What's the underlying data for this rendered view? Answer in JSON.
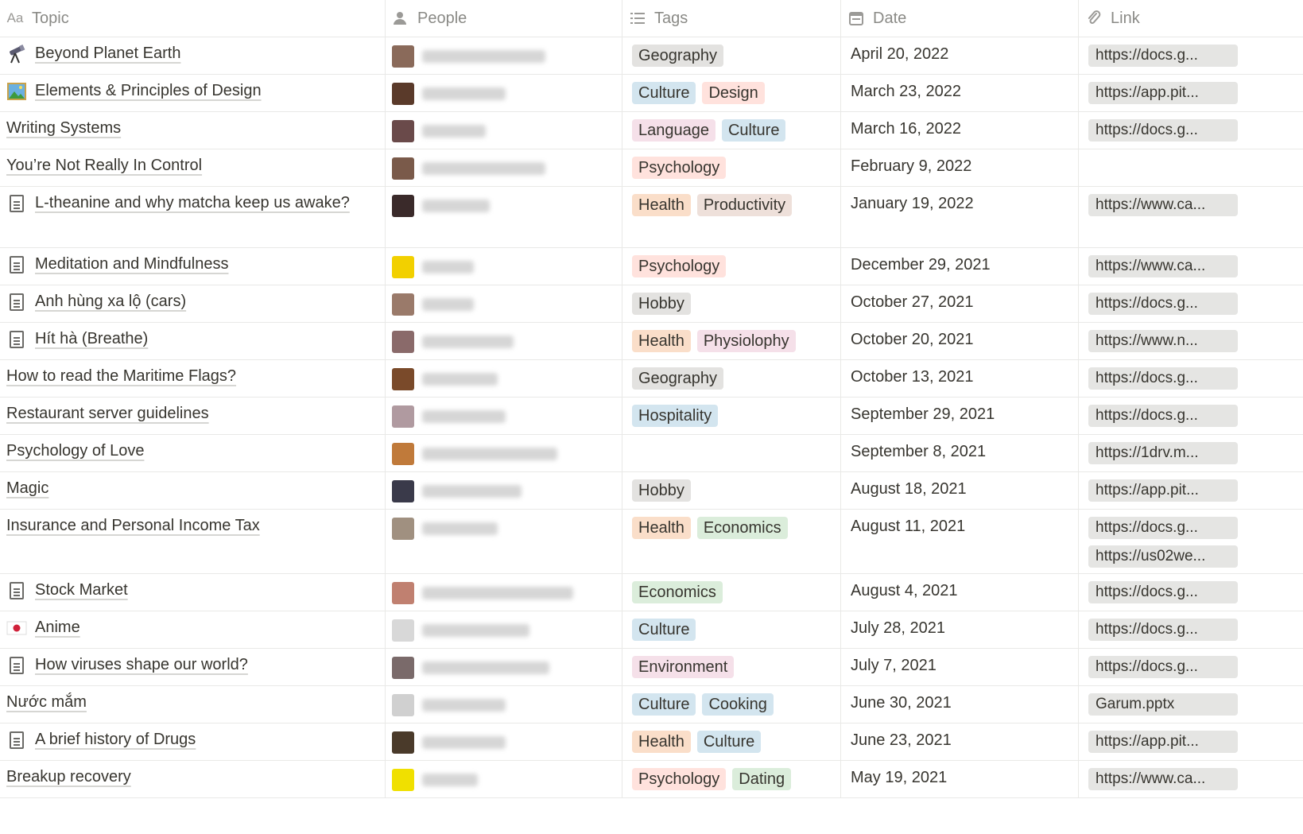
{
  "headers": {
    "topic": "Topic",
    "people": "People",
    "tags": "Tags",
    "date": "Date",
    "link": "Link"
  },
  "header_icons": {
    "topic": "Aa",
    "people": "person-icon",
    "tags": "list-icon",
    "date": "calendar-icon",
    "link": "link-icon"
  },
  "tag_colors": {
    "Geography": "#e3e2e0",
    "Culture": "#d3e5ef",
    "Design": "#ffe2dd",
    "Language": "#f5e0e9",
    "Psychology": "#ffe2dd",
    "Health": "#fadec9",
    "Productivity": "#eee0da",
    "Hobby": "#e3e2e0",
    "Physiolophy": "#f5e0e9",
    "Hospitality": "#d3e5ef",
    "Economics": "#dbeddb",
    "Environment": "#f5e0e9",
    "Cooking": "#d3e5ef",
    "Dating": "#dbeddb"
  },
  "rows": [
    {
      "topic": "Beyond Planet Earth",
      "icon": "telescope",
      "tags": [
        "Geography"
      ],
      "date": "April 20, 2022",
      "links": [
        "https://docs.g..."
      ],
      "avatar": "#8a6a5a",
      "blur": [
        155
      ]
    },
    {
      "topic": "Elements & Principles of Design",
      "icon": "picture",
      "tags": [
        "Culture",
        "Design"
      ],
      "date": "March 23, 2022",
      "links": [
        "https://app.pit..."
      ],
      "avatar": "#5a3a2a",
      "blur": [
        105
      ]
    },
    {
      "topic": "Writing Systems",
      "icon": "",
      "tags": [
        "Language",
        "Culture"
      ],
      "date": "March 16, 2022",
      "links": [
        "https://docs.g..."
      ],
      "avatar": "#6a4a4a",
      "blur": [
        80
      ]
    },
    {
      "topic": "You’re Not Really In Control",
      "icon": "",
      "tags": [
        "Psychology"
      ],
      "date": "February 9, 2022",
      "links": [],
      "avatar": "#7a5a4a",
      "blur": [
        155
      ]
    },
    {
      "topic": "L-theanine and why matcha keep us awake?",
      "icon": "doc",
      "tags": [
        "Health",
        "Productivity"
      ],
      "date": "January 19, 2022",
      "links": [
        "https://www.ca..."
      ],
      "avatar": "#3a2a2a",
      "blur": [
        85
      ]
    },
    {
      "topic": "Meditation and Mindfulness",
      "icon": "doc",
      "tags": [
        "Psychology"
      ],
      "date": "December 29, 2021",
      "links": [
        "https://www.ca..."
      ],
      "avatar": "#f2d000",
      "blur": [
        65
      ]
    },
    {
      "topic": "Anh hùng xa lộ (cars)",
      "icon": "doc",
      "tags": [
        "Hobby"
      ],
      "date": "October 27, 2021",
      "links": [
        "https://docs.g..."
      ],
      "avatar": "#9a7a6a",
      "blur": [
        65
      ]
    },
    {
      "topic": "Hít hà (Breathe)",
      "icon": "doc",
      "tags": [
        "Health",
        "Physiolophy"
      ],
      "date": "October 20, 2021",
      "links": [
        "https://www.n..."
      ],
      "avatar": "#8a6a6a",
      "blur": [
        115
      ]
    },
    {
      "topic": "How to read the Maritime Flags?",
      "icon": "",
      "tags": [
        "Geography"
      ],
      "date": "October 13, 2021",
      "links": [
        "https://docs.g..."
      ],
      "avatar": "#7a4a2a",
      "blur": [
        95
      ]
    },
    {
      "topic": "Restaurant server guidelines",
      "icon": "",
      "tags": [
        "Hospitality"
      ],
      "date": "September 29, 2021",
      "links": [
        "https://docs.g..."
      ],
      "avatar": "#b09aa0",
      "blur": [
        105
      ]
    },
    {
      "topic": "Psychology of Love",
      "icon": "",
      "tags": [],
      "date": "September 8, 2021",
      "links": [
        "https://1drv.m..."
      ],
      "avatar": "#c07a3a",
      "blur": [
        170
      ]
    },
    {
      "topic": "Magic",
      "icon": "",
      "tags": [
        "Hobby"
      ],
      "date": "August 18, 2021",
      "links": [
        "https://app.pit..."
      ],
      "avatar": "#3a3a4a",
      "blur": [
        125
      ]
    },
    {
      "topic": "Insurance and Personal Income Tax",
      "icon": "",
      "tags": [
        "Health",
        "Economics"
      ],
      "date": "August 11, 2021",
      "links": [
        "https://docs.g...",
        "https://us02we..."
      ],
      "avatar": "#a09080",
      "blur": [
        95
      ]
    },
    {
      "topic": "Stock Market",
      "icon": "doc",
      "tags": [
        "Economics"
      ],
      "date": "August 4, 2021",
      "links": [
        "https://docs.g..."
      ],
      "avatar": "#c08070",
      "blur": [
        190
      ]
    },
    {
      "topic": "Anime",
      "icon": "flag",
      "tags": [
        "Culture"
      ],
      "date": "July 28, 2021",
      "links": [
        "https://docs.g..."
      ],
      "avatar": "#d8d8d8",
      "blur": [
        135
      ]
    },
    {
      "topic": "How viruses shape our world?",
      "icon": "doc",
      "tags": [
        "Environment"
      ],
      "date": "July 7, 2021",
      "links": [
        "https://docs.g..."
      ],
      "avatar": "#7a6a6a",
      "blur": [
        160
      ]
    },
    {
      "topic": "Nước mắm",
      "icon": "",
      "tags": [
        "Culture",
        "Cooking"
      ],
      "date": "June 30, 2021",
      "links": [
        "Garum.pptx"
      ],
      "avatar": "#d0d0d0",
      "blur": [
        105
      ]
    },
    {
      "topic": "A brief history of Drugs",
      "icon": "doc",
      "tags": [
        "Health",
        "Culture"
      ],
      "date": "June 23, 2021",
      "links": [
        "https://app.pit..."
      ],
      "avatar": "#4a3a2a",
      "blur": [
        105
      ]
    },
    {
      "topic": "Breakup recovery",
      "icon": "",
      "tags": [
        "Psychology",
        "Dating"
      ],
      "date": "May 19, 2021",
      "links": [
        "https://www.ca..."
      ],
      "avatar": "#f0e000",
      "blur": [
        70
      ]
    }
  ]
}
